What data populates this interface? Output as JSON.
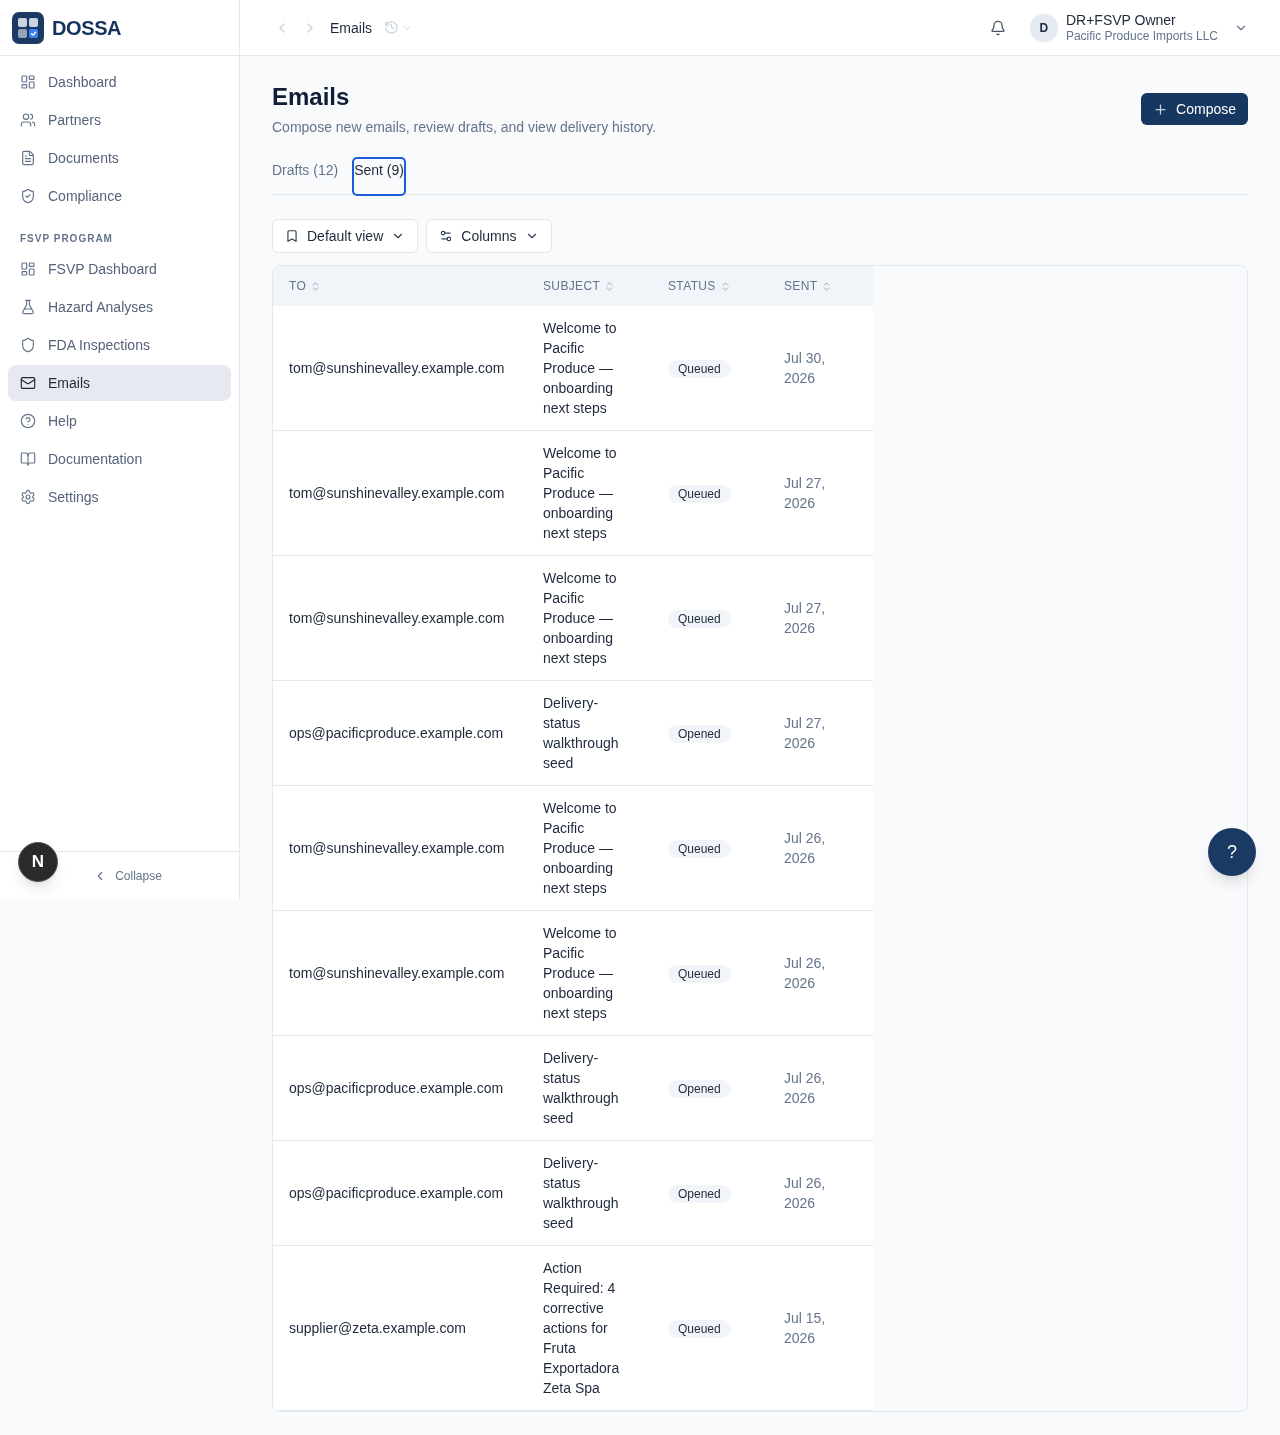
{
  "sidebar": {
    "brand": "DOSSA",
    "groups": [
      {
        "items": [
          {
            "label": "Dashboard",
            "selected": false
          },
          {
            "label": "Partners",
            "selected": false
          },
          {
            "label": "Documents",
            "selected": false
          },
          {
            "label": "Compliance",
            "selected": false
          }
        ]
      },
      {
        "heading": "FSVP PROGRAM",
        "items": [
          {
            "label": "FSVP Dashboard",
            "selected": false
          },
          {
            "label": "Hazard Analyses",
            "selected": false
          },
          {
            "label": "FDA Inspections",
            "selected": false
          },
          {
            "label": "Emails",
            "selected": true
          },
          {
            "label": "Help",
            "selected": false
          },
          {
            "label": "Documentation",
            "selected": false
          },
          {
            "label": "Settings",
            "selected": false
          }
        ]
      }
    ],
    "collapse": "Collapse"
  },
  "topbar": {
    "breadcrumb": "Emails",
    "user": {
      "initial": "D",
      "name": "DR+FSVP Owner",
      "organization": "Pacific Produce Imports LLC"
    }
  },
  "page": {
    "title": "Emails",
    "subtitle": "Compose new emails, review drafts, and view delivery history.",
    "compose_button": "Compose"
  },
  "tabs": [
    {
      "label": "Drafts (12)",
      "selected": false
    },
    {
      "label": "Sent (9)",
      "selected": true
    }
  ],
  "toolbar": [
    {
      "label": "Default view"
    },
    {
      "label": "Columns"
    }
  ],
  "table": {
    "columns": [
      "TO",
      "SUBJECT",
      "STATUS",
      "SENT"
    ],
    "rows": [
      {
        "to": "tom@sunshinevalley.example.com",
        "subject": "Welcome to Pacific Produce — onboarding next steps",
        "status": "Queued",
        "sent": "Jul 30, 2026"
      },
      {
        "to": "tom@sunshinevalley.example.com",
        "subject": "Welcome to Pacific Produce — onboarding next steps",
        "status": "Queued",
        "sent": "Jul 27, 2026"
      },
      {
        "to": "tom@sunshinevalley.example.com",
        "subject": "Welcome to Pacific Produce — onboarding next steps",
        "status": "Queued",
        "sent": "Jul 27, 2026"
      },
      {
        "to": "ops@pacificproduce.example.com",
        "subject": "Delivery-status walkthrough seed",
        "status": "Opened",
        "sent": "Jul 27, 2026"
      },
      {
        "to": "tom@sunshinevalley.example.com",
        "subject": "Welcome to Pacific Produce — onboarding next steps",
        "status": "Queued",
        "sent": "Jul 26, 2026"
      },
      {
        "to": "tom@sunshinevalley.example.com",
        "subject": "Welcome to Pacific Produce — onboarding next steps",
        "status": "Queued",
        "sent": "Jul 26, 2026"
      },
      {
        "to": "ops@pacificproduce.example.com",
        "subject": "Delivery-status walkthrough seed",
        "status": "Opened",
        "sent": "Jul 26, 2026"
      },
      {
        "to": "ops@pacificproduce.example.com",
        "subject": "Delivery-status walkthrough seed",
        "status": "Opened",
        "sent": "Jul 26, 2026"
      },
      {
        "to": "supplier@zeta.example.com",
        "subject": "Action Required: 4 corrective actions for Fruta Exportadora Zeta Spa",
        "status": "Queued",
        "sent": "Jul 15, 2026"
      }
    ]
  },
  "help_button": "?",
  "dev_indicator": "N"
}
